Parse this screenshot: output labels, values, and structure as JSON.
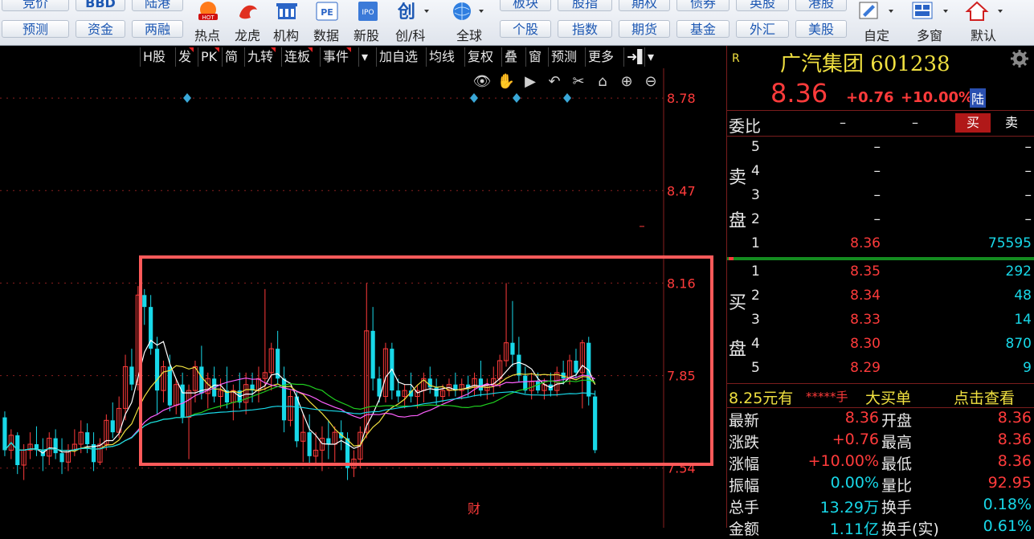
{
  "toolbar": {
    "top_row": [
      "竞价",
      "BBD",
      "陆港",
      "板块",
      "股指",
      "期权",
      "债券",
      "英股",
      "港股"
    ],
    "bottom_buttons": [
      "预测",
      "资金",
      "两融",
      "个股",
      "指数",
      "期货",
      "基金",
      "外汇",
      "美股"
    ],
    "icon_labels": [
      "热点",
      "龙虎",
      "机构",
      "数据",
      "新股",
      "创/科",
      "全球",
      "自定",
      "多窗",
      "默认"
    ],
    "icon_texts": {
      "hot": "HOT",
      "pe": "PE",
      "ipo": "IPO",
      "chuang": "创"
    }
  },
  "chart_toolbar": {
    "buttons": [
      "H股",
      "发",
      "PK",
      "简",
      "九转",
      "连板",
      "事件",
      "加自选",
      "均线",
      "复权",
      "叠",
      "窗",
      "预测",
      "更多"
    ],
    "dropdown_glyph": "▾",
    "more_glyph": "➜▌"
  },
  "chart_tools": [
    "👁",
    "✋",
    "▶",
    "↶",
    "✂",
    "⌂",
    "⊕",
    "⊖"
  ],
  "chart_data": {
    "type": "candlestick",
    "price_axis": {
      "ticks": [
        8.78,
        8.47,
        8.16,
        7.85,
        7.54
      ],
      "range": [
        7.34,
        8.88
      ]
    },
    "finance_marker": "财",
    "candles": [
      {
        "o": 7.71,
        "h": 7.73,
        "l": 7.58,
        "c": 7.6
      },
      {
        "o": 7.6,
        "h": 7.67,
        "l": 7.57,
        "c": 7.65
      },
      {
        "o": 7.65,
        "h": 7.66,
        "l": 7.52,
        "c": 7.55
      },
      {
        "o": 7.55,
        "h": 7.62,
        "l": 7.5,
        "c": 7.6
      },
      {
        "o": 7.6,
        "h": 7.66,
        "l": 7.57,
        "c": 7.62
      },
      {
        "o": 7.62,
        "h": 7.68,
        "l": 7.58,
        "c": 7.6
      },
      {
        "o": 7.6,
        "h": 7.64,
        "l": 7.53,
        "c": 7.58
      },
      {
        "o": 7.58,
        "h": 7.66,
        "l": 7.55,
        "c": 7.64
      },
      {
        "o": 7.64,
        "h": 7.67,
        "l": 7.57,
        "c": 7.59
      },
      {
        "o": 7.59,
        "h": 7.64,
        "l": 7.52,
        "c": 7.56
      },
      {
        "o": 7.56,
        "h": 7.62,
        "l": 7.53,
        "c": 7.6
      },
      {
        "o": 7.6,
        "h": 7.67,
        "l": 7.58,
        "c": 7.62
      },
      {
        "o": 7.62,
        "h": 7.7,
        "l": 7.59,
        "c": 7.66
      },
      {
        "o": 7.66,
        "h": 7.69,
        "l": 7.59,
        "c": 7.62
      },
      {
        "o": 7.62,
        "h": 7.66,
        "l": 7.53,
        "c": 7.56
      },
      {
        "o": 7.56,
        "h": 7.64,
        "l": 7.55,
        "c": 7.62
      },
      {
        "o": 7.62,
        "h": 7.72,
        "l": 7.6,
        "c": 7.7
      },
      {
        "o": 7.7,
        "h": 7.76,
        "l": 7.64,
        "c": 7.66
      },
      {
        "o": 7.66,
        "h": 7.78,
        "l": 7.64,
        "c": 7.74
      },
      {
        "o": 7.74,
        "h": 7.92,
        "l": 7.7,
        "c": 7.88
      },
      {
        "o": 7.88,
        "h": 7.94,
        "l": 7.8,
        "c": 7.82
      },
      {
        "o": 7.82,
        "h": 8.15,
        "l": 7.8,
        "c": 8.12
      },
      {
        "o": 8.12,
        "h": 8.14,
        "l": 8.02,
        "c": 8.08
      },
      {
        "o": 8.08,
        "h": 8.12,
        "l": 7.92,
        "c": 7.94
      },
      {
        "o": 7.94,
        "h": 7.98,
        "l": 7.72,
        "c": 7.8
      },
      {
        "o": 7.8,
        "h": 7.9,
        "l": 7.76,
        "c": 7.88
      },
      {
        "o": 7.88,
        "h": 7.92,
        "l": 7.73,
        "c": 7.75
      },
      {
        "o": 7.75,
        "h": 7.84,
        "l": 7.72,
        "c": 7.82
      },
      {
        "o": 7.82,
        "h": 7.86,
        "l": 7.69,
        "c": 7.71
      },
      {
        "o": 7.71,
        "h": 7.82,
        "l": 7.57,
        "c": 7.8
      },
      {
        "o": 7.8,
        "h": 7.9,
        "l": 7.76,
        "c": 7.88
      },
      {
        "o": 7.88,
        "h": 7.95,
        "l": 7.77,
        "c": 7.79
      },
      {
        "o": 7.79,
        "h": 7.86,
        "l": 7.74,
        "c": 7.84
      },
      {
        "o": 7.84,
        "h": 7.88,
        "l": 7.76,
        "c": 7.78
      },
      {
        "o": 7.78,
        "h": 7.84,
        "l": 7.74,
        "c": 7.8
      },
      {
        "o": 7.8,
        "h": 7.88,
        "l": 7.74,
        "c": 7.76
      },
      {
        "o": 7.76,
        "h": 7.82,
        "l": 7.7,
        "c": 7.8
      },
      {
        "o": 7.8,
        "h": 7.86,
        "l": 7.74,
        "c": 7.76
      },
      {
        "o": 7.76,
        "h": 7.86,
        "l": 7.72,
        "c": 7.82
      },
      {
        "o": 7.82,
        "h": 7.86,
        "l": 7.76,
        "c": 7.8
      },
      {
        "o": 7.8,
        "h": 7.88,
        "l": 7.76,
        "c": 7.84
      },
      {
        "o": 7.84,
        "h": 8.14,
        "l": 7.8,
        "c": 7.86
      },
      {
        "o": 7.86,
        "h": 7.96,
        "l": 7.8,
        "c": 7.94
      },
      {
        "o": 7.94,
        "h": 8.0,
        "l": 7.82,
        "c": 7.84
      },
      {
        "o": 7.84,
        "h": 7.88,
        "l": 7.66,
        "c": 7.7
      },
      {
        "o": 7.7,
        "h": 7.8,
        "l": 7.68,
        "c": 7.78
      },
      {
        "o": 7.78,
        "h": 7.8,
        "l": 7.61,
        "c": 7.63
      },
      {
        "o": 7.63,
        "h": 7.72,
        "l": 7.56,
        "c": 7.66
      },
      {
        "o": 7.66,
        "h": 7.72,
        "l": 7.55,
        "c": 7.58
      },
      {
        "o": 7.58,
        "h": 7.66,
        "l": 7.55,
        "c": 7.6
      },
      {
        "o": 7.6,
        "h": 7.68,
        "l": 7.53,
        "c": 7.64
      },
      {
        "o": 7.64,
        "h": 7.7,
        "l": 7.57,
        "c": 7.62
      },
      {
        "o": 7.62,
        "h": 7.68,
        "l": 7.56,
        "c": 7.66
      },
      {
        "o": 7.66,
        "h": 7.7,
        "l": 7.6,
        "c": 7.64
      },
      {
        "o": 7.64,
        "h": 7.66,
        "l": 7.5,
        "c": 7.54
      },
      {
        "o": 7.54,
        "h": 7.6,
        "l": 7.51,
        "c": 7.57
      },
      {
        "o": 7.57,
        "h": 7.68,
        "l": 7.54,
        "c": 7.66
      },
      {
        "o": 7.66,
        "h": 8.16,
        "l": 7.64,
        "c": 8.0
      },
      {
        "o": 8.0,
        "h": 8.08,
        "l": 7.8,
        "c": 7.84
      },
      {
        "o": 7.84,
        "h": 7.88,
        "l": 7.76,
        "c": 7.78
      },
      {
        "o": 7.78,
        "h": 7.96,
        "l": 7.76,
        "c": 7.94
      },
      {
        "o": 7.94,
        "h": 7.96,
        "l": 7.77,
        "c": 7.8
      },
      {
        "o": 7.8,
        "h": 7.84,
        "l": 7.76,
        "c": 7.78
      },
      {
        "o": 7.78,
        "h": 7.82,
        "l": 7.74,
        "c": 7.8
      },
      {
        "o": 7.8,
        "h": 7.86,
        "l": 7.76,
        "c": 7.78
      },
      {
        "o": 7.78,
        "h": 7.82,
        "l": 7.74,
        "c": 7.8
      },
      {
        "o": 7.8,
        "h": 7.86,
        "l": 7.76,
        "c": 7.84
      },
      {
        "o": 7.84,
        "h": 7.88,
        "l": 7.79,
        "c": 7.81
      },
      {
        "o": 7.81,
        "h": 7.84,
        "l": 7.75,
        "c": 7.78
      },
      {
        "o": 7.78,
        "h": 7.82,
        "l": 7.76,
        "c": 7.8
      },
      {
        "o": 7.8,
        "h": 7.84,
        "l": 7.78,
        "c": 7.82
      },
      {
        "o": 7.82,
        "h": 7.86,
        "l": 7.78,
        "c": 7.8
      },
      {
        "o": 7.8,
        "h": 7.84,
        "l": 7.77,
        "c": 7.82
      },
      {
        "o": 7.82,
        "h": 7.85,
        "l": 7.78,
        "c": 7.81
      },
      {
        "o": 7.81,
        "h": 7.86,
        "l": 7.78,
        "c": 7.84
      },
      {
        "o": 7.84,
        "h": 7.9,
        "l": 7.78,
        "c": 7.8
      },
      {
        "o": 7.8,
        "h": 7.84,
        "l": 7.77,
        "c": 7.82
      },
      {
        "o": 7.82,
        "h": 7.88,
        "l": 7.78,
        "c": 7.84
      },
      {
        "o": 7.84,
        "h": 7.92,
        "l": 7.81,
        "c": 7.9
      },
      {
        "o": 7.9,
        "h": 8.16,
        "l": 7.88,
        "c": 7.96
      },
      {
        "o": 7.96,
        "h": 8.1,
        "l": 7.88,
        "c": 7.92
      },
      {
        "o": 7.92,
        "h": 7.98,
        "l": 7.83,
        "c": 7.85
      },
      {
        "o": 7.85,
        "h": 7.88,
        "l": 7.79,
        "c": 7.8
      },
      {
        "o": 7.8,
        "h": 7.86,
        "l": 7.77,
        "c": 7.83
      },
      {
        "o": 7.83,
        "h": 7.86,
        "l": 7.79,
        "c": 7.8
      },
      {
        "o": 7.8,
        "h": 7.84,
        "l": 7.77,
        "c": 7.82
      },
      {
        "o": 7.82,
        "h": 7.86,
        "l": 7.78,
        "c": 7.8
      },
      {
        "o": 7.8,
        "h": 7.88,
        "l": 7.78,
        "c": 7.86
      },
      {
        "o": 7.86,
        "h": 7.9,
        "l": 7.82,
        "c": 7.84
      },
      {
        "o": 7.84,
        "h": 7.92,
        "l": 7.82,
        "c": 7.9
      },
      {
        "o": 7.9,
        "h": 7.94,
        "l": 7.84,
        "c": 7.86
      },
      {
        "o": 7.86,
        "h": 7.97,
        "l": 7.74,
        "c": 7.96
      },
      {
        "o": 7.96,
        "h": 7.98,
        "l": 7.75,
        "c": 7.78
      },
      {
        "o": 7.78,
        "h": 7.8,
        "l": 7.59,
        "c": 7.6
      }
    ],
    "ma_colors": [
      "#ffffff",
      "#f0e040",
      "#ff60ff",
      "#20d020",
      "#18d8e8"
    ],
    "ma_periods": [
      5,
      10,
      20,
      30,
      60
    ]
  },
  "highlight_box_color": "#ff5a5a",
  "stock": {
    "r_badge": "R",
    "name": "广汽集团",
    "code": "601238",
    "price": "8.36",
    "change": "+0.76",
    "change_pct": "+10.00%",
    "market_badge": "陆"
  },
  "order_book": {
    "weibi_label": "委比",
    "weibi_value": "–",
    "weicha_value": "–",
    "buy_button": "买",
    "sell_button": "卖",
    "sell_label_1": "卖",
    "sell_label_2": "盘",
    "buy_label_1": "买",
    "buy_label_2": "盘",
    "asks": [
      {
        "level": "5",
        "price": "–",
        "volume": "–"
      },
      {
        "level": "4",
        "price": "–",
        "volume": "–"
      },
      {
        "level": "3",
        "price": "–",
        "volume": "–"
      },
      {
        "level": "2",
        "price": "–",
        "volume": "–"
      },
      {
        "level": "1",
        "price": "8.36",
        "volume": "75595"
      }
    ],
    "bids": [
      {
        "level": "1",
        "price": "8.35",
        "volume": "292"
      },
      {
        "level": "2",
        "price": "8.34",
        "volume": "48"
      },
      {
        "level": "3",
        "price": "8.33",
        "volume": "14"
      },
      {
        "level": "4",
        "price": "8.30",
        "volume": "870"
      },
      {
        "level": "5",
        "price": "8.29",
        "volume": "9"
      }
    ]
  },
  "big_order": {
    "price": "8.25元有",
    "stars": "*****手",
    "label": "大买单",
    "link": "点击查看"
  },
  "quote_stats": [
    {
      "l1": "最新",
      "v1": "8.36",
      "l2": "开盘",
      "v2": "8.36"
    },
    {
      "l1": "涨跌",
      "v1": "+0.76",
      "l2": "最高",
      "v2": "8.36"
    },
    {
      "l1": "涨幅",
      "v1": "+10.00%",
      "l2": "最低",
      "v2": "8.36"
    },
    {
      "l1": "振幅",
      "v1": "0.00%",
      "l2": "量比",
      "v2": "92.95"
    },
    {
      "l1": "总手",
      "v1": "13.29万",
      "l2": "换手",
      "v2": "0.18%"
    },
    {
      "l1": "金额",
      "v1": "1.11亿",
      "l2": "换手(实)",
      "v2": "0.61%"
    }
  ]
}
